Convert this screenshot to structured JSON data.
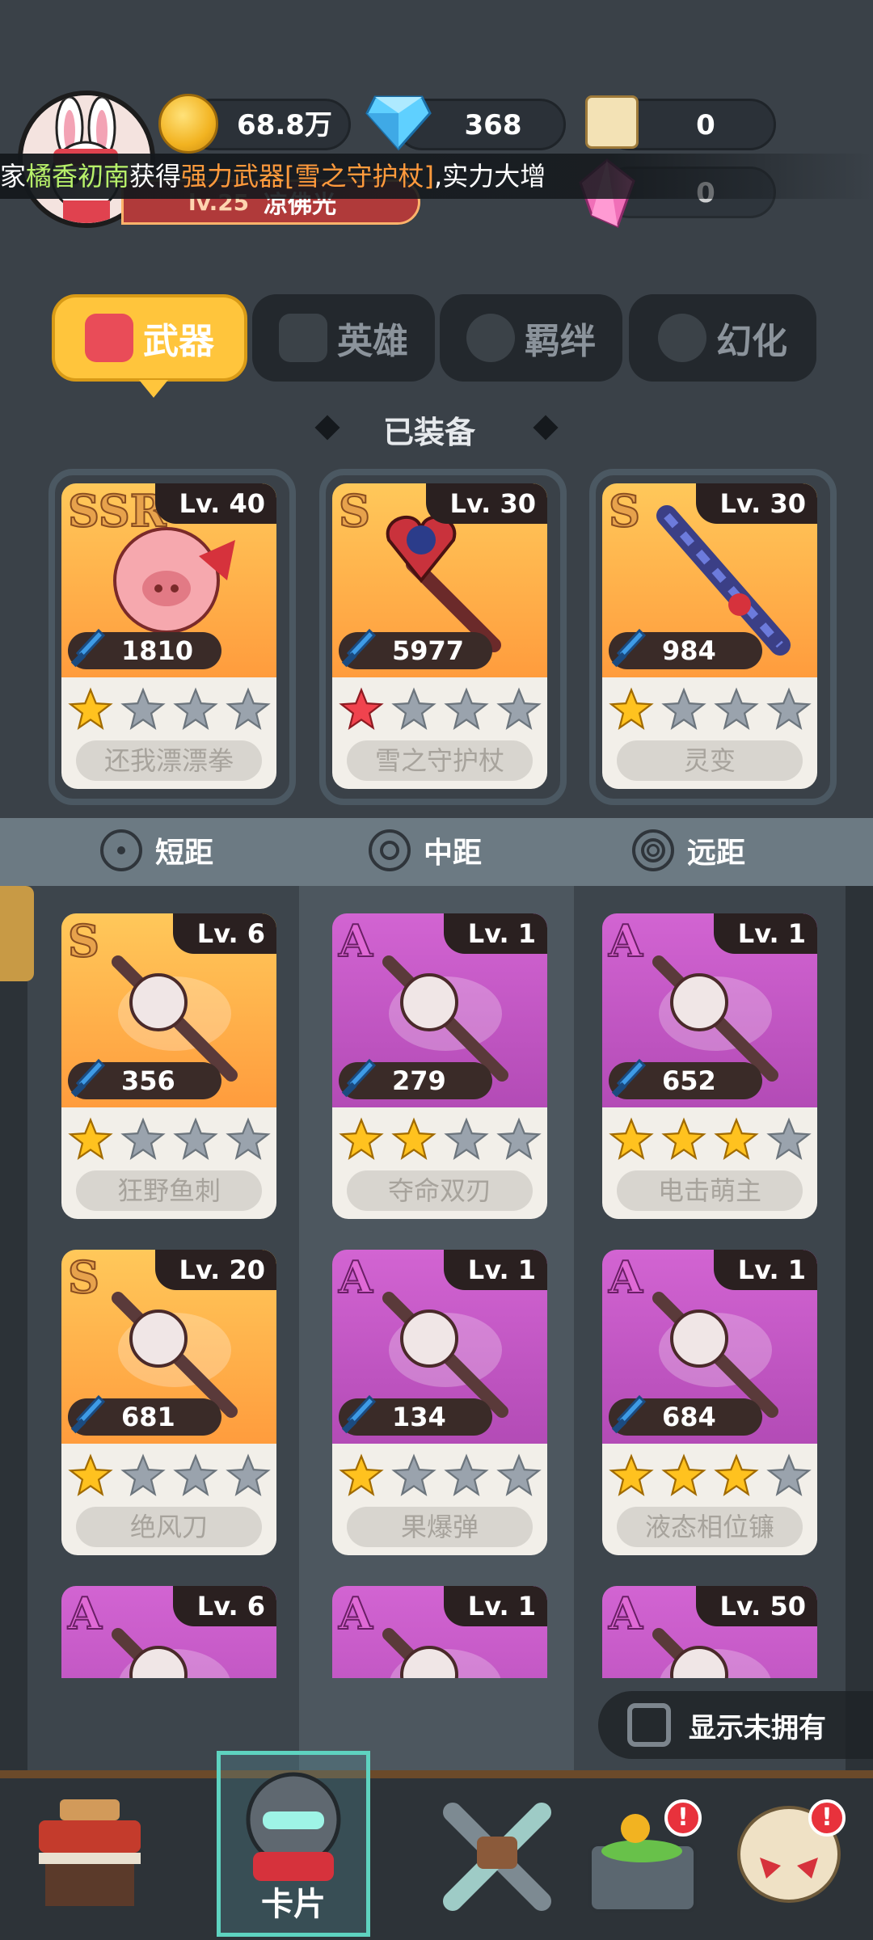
{
  "header": {
    "player_level": "lv.25",
    "player_name": "凉佛光",
    "coins": "68.8万",
    "diamonds": "368",
    "scrolls": "0",
    "crystals": "0"
  },
  "broadcast": {
    "prefix": "家",
    "player": "橘香初南",
    "mid": "获得",
    "item": "强力武器[雪之守护杖]",
    "suffix": ",实力大增"
  },
  "tabs": [
    {
      "label": "武器",
      "active": true
    },
    {
      "label": "英雄",
      "active": false
    },
    {
      "label": "羁绊",
      "active": false
    },
    {
      "label": "幻化",
      "active": false
    }
  ],
  "equipped_title": "已装备",
  "equipped": [
    {
      "rank": "SSR",
      "level": "Lv. 40",
      "power": "1810",
      "stars": 1,
      "star_color": "#ffc21f",
      "name": "还我漂漂拳",
      "bg": "s"
    },
    {
      "rank": "S",
      "level": "Lv. 30",
      "power": "5977",
      "stars": 1,
      "star_color": "#f0434e",
      "name": "雪之守护杖",
      "bg": "s"
    },
    {
      "rank": "S",
      "level": "Lv. 30",
      "power": "984",
      "stars": 1,
      "star_color": "#ffc21f",
      "name": "灵变",
      "bg": "s"
    }
  ],
  "ranges": [
    "短距",
    "中距",
    "远距"
  ],
  "inventory": [
    {
      "rank": "S",
      "level": "Lv. 6",
      "power": "356",
      "stars": 1,
      "name": "狂野鱼刺",
      "bg": "s"
    },
    {
      "rank": "A",
      "level": "Lv. 1",
      "power": "279",
      "stars": 2,
      "name": "夺命双刃",
      "bg": "a"
    },
    {
      "rank": "A",
      "level": "Lv. 1",
      "power": "652",
      "stars": 3,
      "name": "电击萌主",
      "bg": "a"
    },
    {
      "rank": "S",
      "level": "Lv. 20",
      "power": "681",
      "stars": 1,
      "name": "绝风刀",
      "bg": "s"
    },
    {
      "rank": "A",
      "level": "Lv. 1",
      "power": "134",
      "stars": 1,
      "name": "果爆弹",
      "bg": "a"
    },
    {
      "rank": "A",
      "level": "Lv. 1",
      "power": "684",
      "stars": 3,
      "name": "液态相位镰",
      "bg": "a"
    },
    {
      "rank": "A",
      "level": "Lv. 6",
      "bg": "a"
    },
    {
      "rank": "A",
      "level": "Lv. 1",
      "bg": "a"
    },
    {
      "rank": "A",
      "level": "Lv. 50",
      "bg": "a"
    }
  ],
  "show_unowned_label": "显示未拥有",
  "nav": [
    {
      "icon": "shop-icon"
    },
    {
      "icon": "card-knight-icon",
      "label": "卡片",
      "active": true
    },
    {
      "icon": "crossed-weapons-icon"
    },
    {
      "icon": "treasure-chest-icon",
      "badge": "!"
    },
    {
      "icon": "skull-boss-icon",
      "badge": "!"
    }
  ],
  "colors": {
    "gold_star": "#ffc21f",
    "empty_star": "#9aa3ad",
    "red_star": "#f0434e",
    "tab_active": "#ffc53c"
  }
}
